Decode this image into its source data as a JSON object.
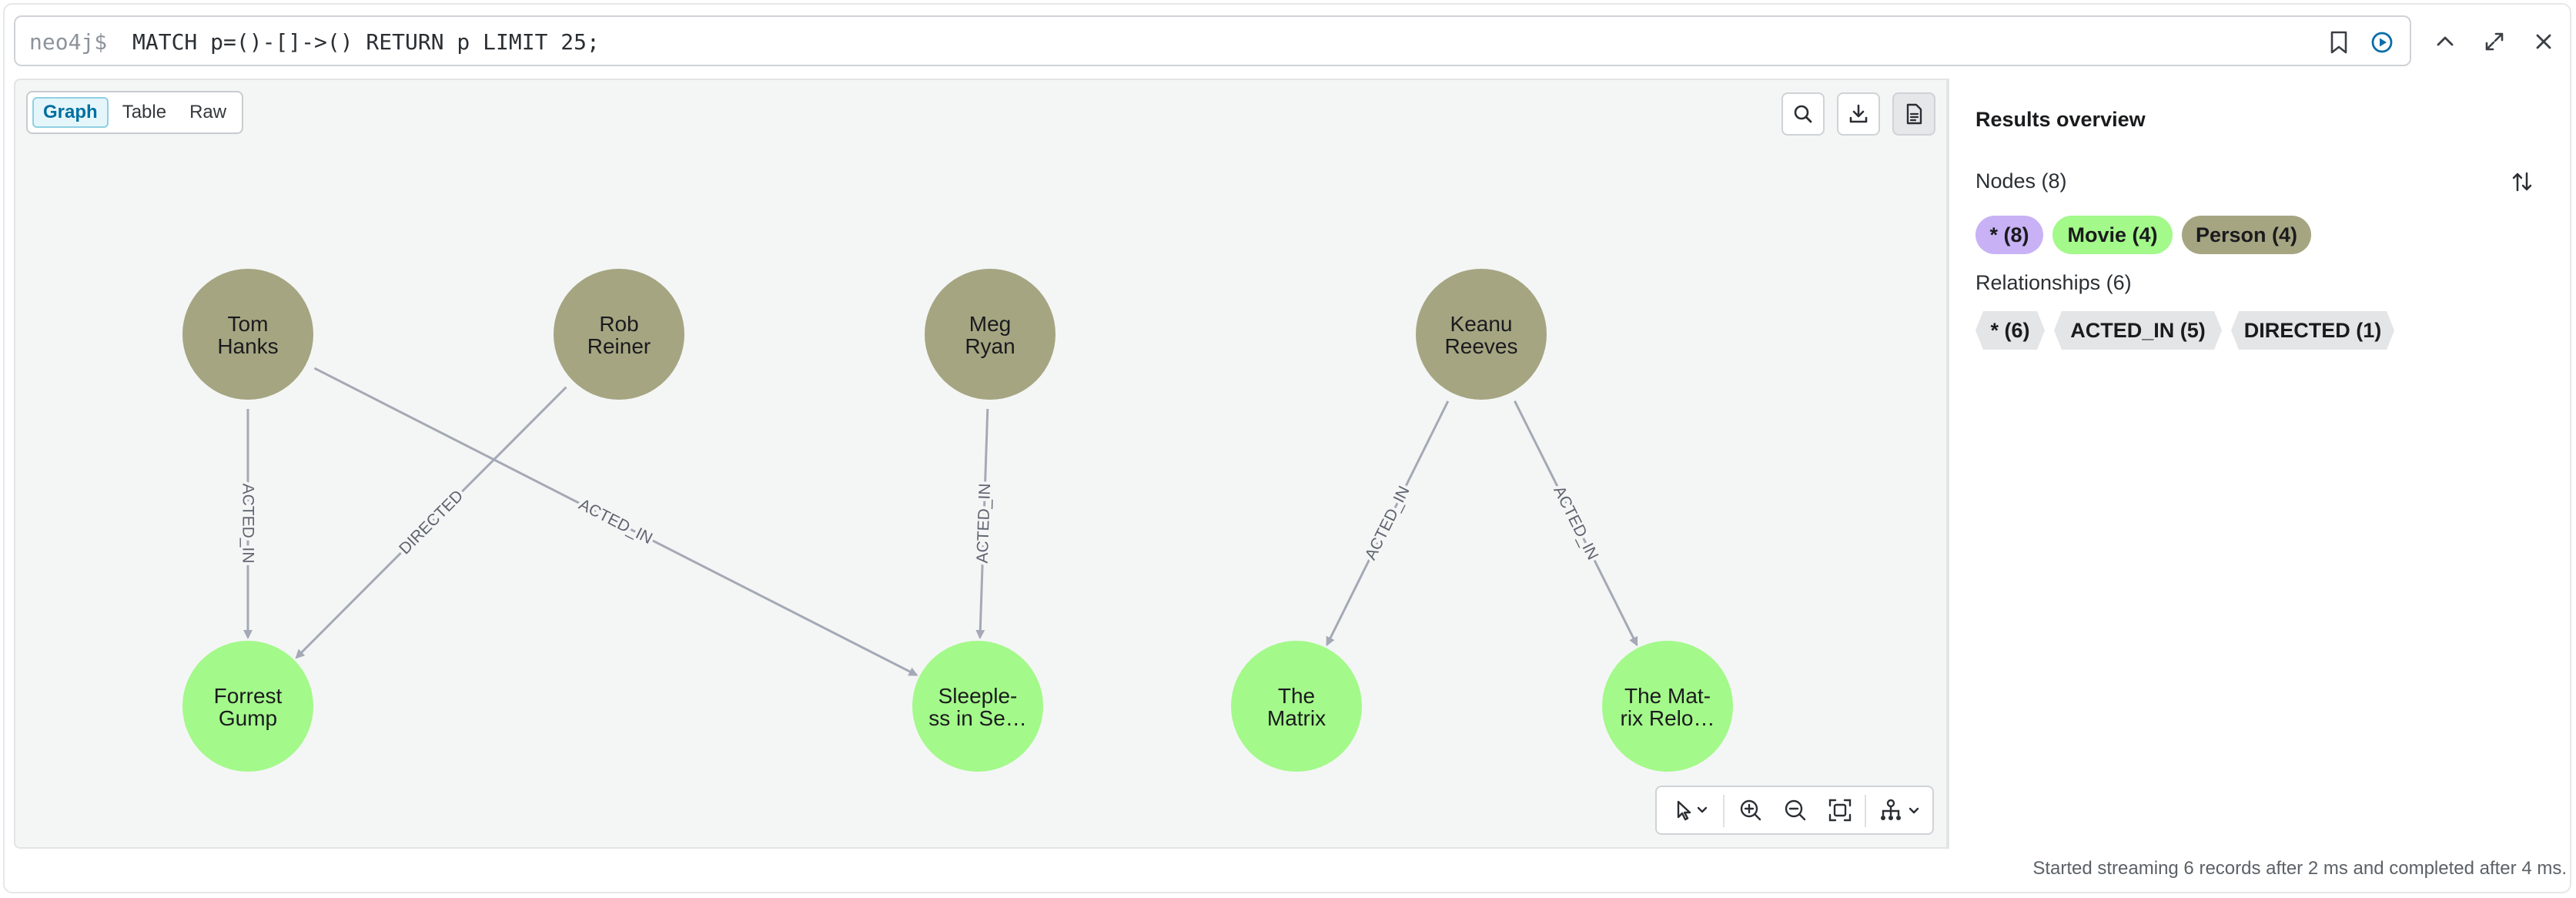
{
  "query": {
    "prompt": "neo4j$",
    "text": "MATCH p=()-[]->() RETURN p LIMIT 25;"
  },
  "view_tabs": [
    {
      "label": "Graph",
      "active": true
    },
    {
      "label": "Table",
      "active": false
    },
    {
      "label": "Raw",
      "active": false
    }
  ],
  "graph": {
    "nodes": [
      {
        "id": "tom",
        "label": [
          "Tom",
          "Hanks"
        ],
        "type": "Person"
      },
      {
        "id": "rob",
        "label": [
          "Rob",
          "Reiner"
        ],
        "type": "Person"
      },
      {
        "id": "meg",
        "label": [
          "Meg",
          "Ryan"
        ],
        "type": "Person"
      },
      {
        "id": "keanu",
        "label": [
          "Keanu",
          "Reeves"
        ],
        "type": "Person"
      },
      {
        "id": "forrest",
        "label": [
          "Forrest",
          "Gump"
        ],
        "type": "Movie"
      },
      {
        "id": "sleepless",
        "label": [
          "Sleeple-",
          "ss in Se…"
        ],
        "type": "Movie"
      },
      {
        "id": "matrix",
        "label": [
          "The",
          "Matrix"
        ],
        "type": "Movie"
      },
      {
        "id": "reloaded",
        "label": [
          "The Mat-",
          "rix Relo…"
        ],
        "type": "Movie"
      }
    ],
    "relationships": [
      {
        "from": "tom",
        "to": "forrest",
        "type": "ACTED_IN"
      },
      {
        "from": "rob",
        "to": "forrest",
        "type": "DIRECTED"
      },
      {
        "from": "tom",
        "to": "sleepless",
        "type": "ACTED_IN"
      },
      {
        "from": "meg",
        "to": "sleepless",
        "type": "ACTED_IN"
      },
      {
        "from": "keanu",
        "to": "matrix",
        "type": "ACTED_IN"
      },
      {
        "from": "keanu",
        "to": "reloaded",
        "type": "ACTED_IN"
      }
    ],
    "colors": {
      "Person": "#a5a582",
      "Movie": "#a3f98a",
      "edge": "#a4a9b5",
      "edge_label": "#5e6470"
    }
  },
  "sidebar": {
    "title": "Results overview",
    "nodes_label": "Nodes (8)",
    "node_chips": [
      {
        "label": "* (8)",
        "color": "#c8b2f5"
      },
      {
        "label": "Movie (4)",
        "color": "#a3f98a"
      },
      {
        "label": "Person (4)",
        "color": "#a5a582"
      }
    ],
    "relationships_label": "Relationships (6)",
    "rel_chips": [
      "* (6)",
      "ACTED_IN (5)",
      "DIRECTED (1)"
    ]
  },
  "status": "Started streaming 6 records after 2 ms and completed after 4 ms."
}
